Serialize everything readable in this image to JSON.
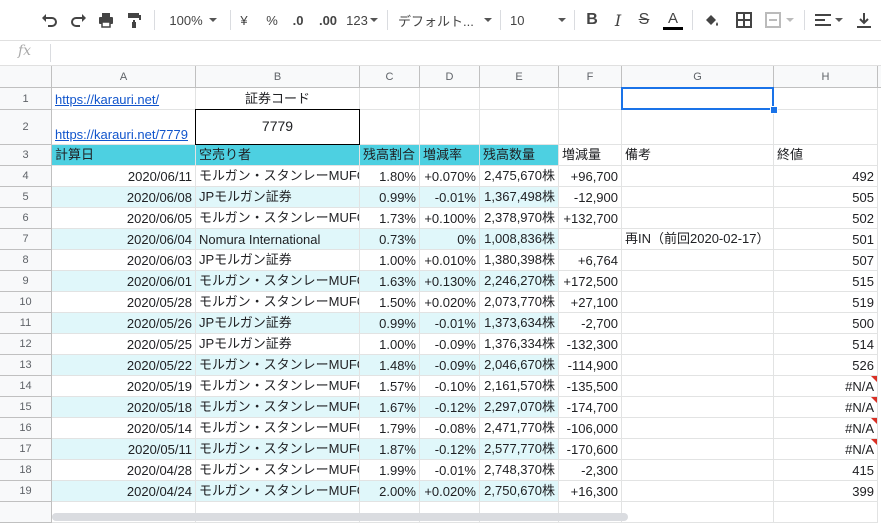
{
  "toolbar": {
    "zoom": "100%",
    "currency": "¥",
    "percent": "%",
    "decimal_less": ".0",
    "decimal_more": ".00",
    "number_format": "123",
    "font": "デフォルト...",
    "font_size": "10"
  },
  "formula_bar": {
    "fx": "fx",
    "value": ""
  },
  "columns": [
    "A",
    "B",
    "C",
    "D",
    "E",
    "F",
    "G",
    "H"
  ],
  "row_numbers": [
    "1",
    "2",
    "3",
    "4",
    "5",
    "6",
    "7",
    "8",
    "9",
    "10",
    "11",
    "12",
    "13",
    "14",
    "15",
    "16",
    "17",
    "18",
    "19"
  ],
  "top": {
    "a1": "https://karauri.net/",
    "b1": "証券コード",
    "a2": "https://karauri.net/7779",
    "b2": "7779"
  },
  "headers": [
    "計算日",
    "空売り者",
    "残高割合",
    "増減率",
    "残高数量",
    "増減量",
    "備考",
    "終値"
  ],
  "rows": [
    [
      "2020/06/11",
      "モルガン・スタンレーMUFG証券",
      "1.80%",
      "+0.070%",
      "2,475,670株",
      "+96,700",
      "",
      "492"
    ],
    [
      "2020/06/08",
      "JPモルガン証券",
      "0.99%",
      "-0.01%",
      "1,367,498株",
      "-12,900",
      "",
      "505"
    ],
    [
      "2020/06/05",
      "モルガン・スタンレーMUFG証券",
      "1.73%",
      "+0.100%",
      "2,378,970株",
      "+132,700",
      "",
      "502"
    ],
    [
      "2020/06/04",
      "Nomura International",
      "0.73%",
      "0%",
      "1,008,836株",
      "",
      "再IN（前回2020-02-17）",
      "501"
    ],
    [
      "2020/06/03",
      "JPモルガン証券",
      "1.00%",
      "+0.010%",
      "1,380,398株",
      "+6,764",
      "",
      "507"
    ],
    [
      "2020/06/01",
      "モルガン・スタンレーMUFG証券",
      "1.63%",
      "+0.130%",
      "2,246,270株",
      "+172,500",
      "",
      "515"
    ],
    [
      "2020/05/28",
      "モルガン・スタンレーMUFG証券",
      "1.50%",
      "+0.020%",
      "2,073,770株",
      "+27,100",
      "",
      "519"
    ],
    [
      "2020/05/26",
      "JPモルガン証券",
      "0.99%",
      "-0.01%",
      "1,373,634株",
      "-2,700",
      "",
      "500"
    ],
    [
      "2020/05/25",
      "JPモルガン証券",
      "1.00%",
      "-0.09%",
      "1,376,334株",
      "-132,300",
      "",
      "514"
    ],
    [
      "2020/05/22",
      "モルガン・スタンレーMUFG証券",
      "1.48%",
      "-0.09%",
      "2,046,670株",
      "-114,900",
      "",
      "526"
    ],
    [
      "2020/05/19",
      "モルガン・スタンレーMUFG証券",
      "1.57%",
      "-0.10%",
      "2,161,570株",
      "-135,500",
      "",
      "#N/A"
    ],
    [
      "2020/05/18",
      "モルガン・スタンレーMUFG証券",
      "1.67%",
      "-0.12%",
      "2,297,070株",
      "-174,700",
      "",
      "#N/A"
    ],
    [
      "2020/05/14",
      "モルガン・スタンレーMUFG証券",
      "1.79%",
      "-0.08%",
      "2,471,770株",
      "-106,000",
      "",
      "#N/A"
    ],
    [
      "2020/05/11",
      "モルガン・スタンレーMUFG証券",
      "1.87%",
      "-0.12%",
      "2,577,770株",
      "-170,600",
      "",
      "#N/A"
    ],
    [
      "2020/04/28",
      "モルガン・スタンレーMUFG証券",
      "1.99%",
      "-0.01%",
      "2,748,370株",
      "-2,300",
      "",
      "415"
    ],
    [
      "2020/04/24",
      "モルガン・スタンレーMUFG証券",
      "2.00%",
      "+0.020%",
      "2,750,670株",
      "+16,300",
      "",
      "399"
    ]
  ],
  "colors": {
    "header_teal": "#4dd0e1",
    "band": "#e0f7fa",
    "link": "#1155cc",
    "selection": "#1a73e8",
    "error_flag": "#d93025"
  }
}
